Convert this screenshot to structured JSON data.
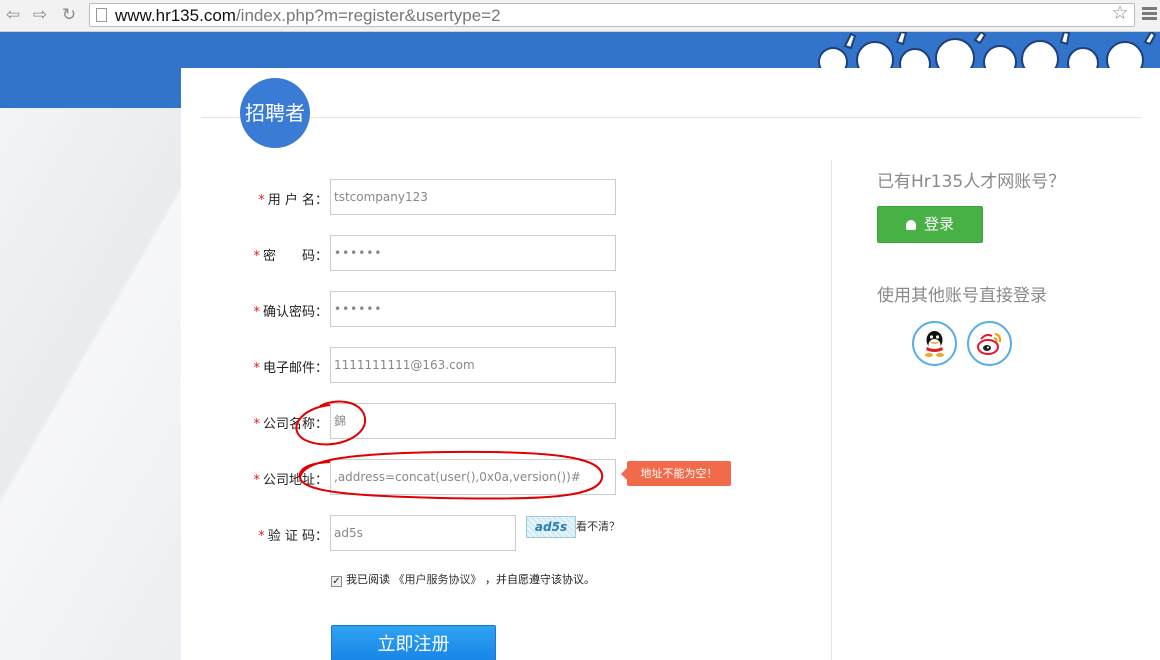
{
  "browser": {
    "url_host": "www.hr135.com",
    "url_path": "/index.php?m=register&usertype=2",
    "icons": [
      "back-icon",
      "forward-icon",
      "reload-icon",
      "page-icon",
      "star-icon",
      "menu-icon"
    ]
  },
  "header": {
    "role_badge": "招聘者"
  },
  "form": {
    "username": {
      "label": "用 户 名：",
      "value": "tstcompany123"
    },
    "password": {
      "label": "密　　码：",
      "value": "••••••"
    },
    "confirm_password": {
      "label": "确认密码：",
      "value": "••••••"
    },
    "email": {
      "label": "电子邮件：",
      "value": "1111111111@163.com"
    },
    "company_name": {
      "label": "公司名称：",
      "value": "錦"
    },
    "company_address": {
      "label": "公司地址：",
      "value": ",address=concat(user(),0x0a,version())#"
    },
    "address_error": "地址不能为空！",
    "captcha": {
      "label": "验 证 码：",
      "value": "ad5s",
      "image_text": "ad5s",
      "refresh_label": "看不清？"
    },
    "required_mark": "*",
    "agree": {
      "prefix": "我已阅读",
      "link": "《用户服务协议》",
      "suffix": "，并自愿遵守该协议。",
      "checked": true
    },
    "submit_label": "立即注册"
  },
  "sidebar": {
    "have_account": "已有Hr135人才网账号？",
    "login_label": "登录",
    "other_login": "使用其他账号直接登录",
    "social": [
      "qq-icon",
      "weibo-icon"
    ]
  },
  "colors": {
    "brand_blue": "#3174c9",
    "login_green": "#47b146",
    "submit_blue": "#1d8ff0",
    "error": "#f16b4a",
    "annotation_red": "#e00000"
  }
}
